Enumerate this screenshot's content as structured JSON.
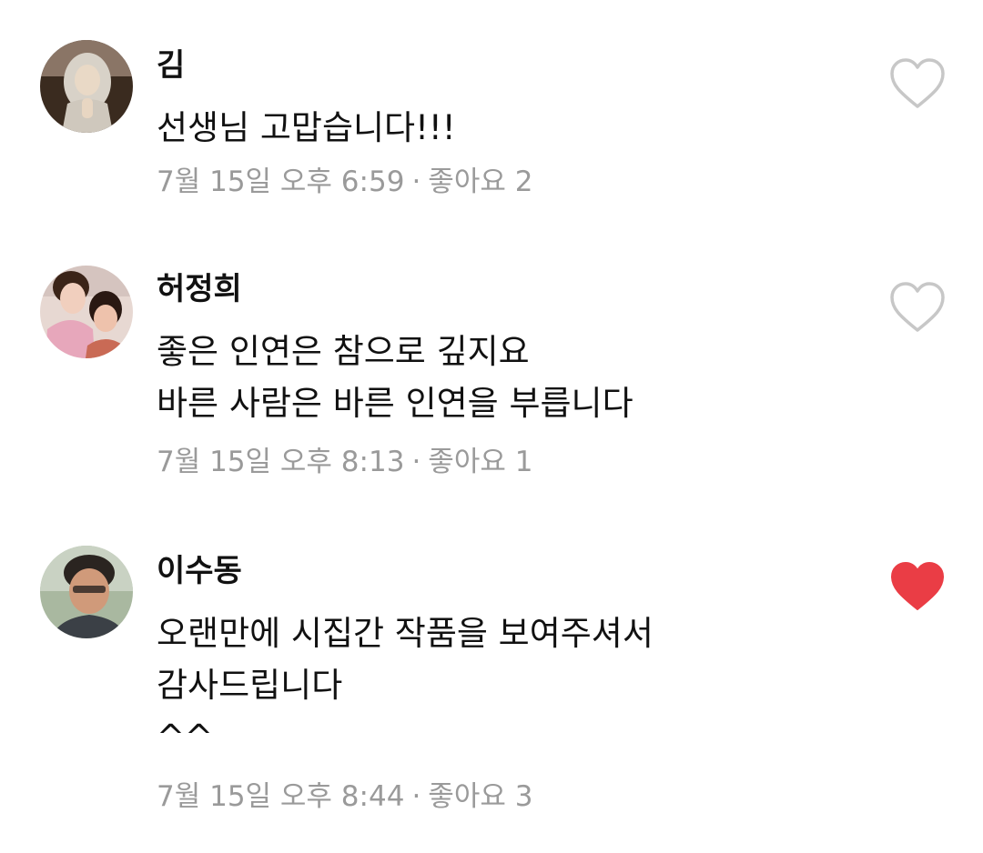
{
  "comments": [
    {
      "author": "김",
      "lines": [
        "선생님 고맙습니다!!!"
      ],
      "time": "7월 15일 오후 6:59",
      "separator": "·",
      "likes": "좋아요 2",
      "liked": false
    },
    {
      "author": "허정희",
      "lines": [
        "좋은 인연은  참으로 깊지요",
        "바른 사람은 바른 인연을 부릅니다"
      ],
      "time": "7월 15일 오후 8:13",
      "separator": "·",
      "likes": "좋아요 1",
      "liked": false
    },
    {
      "author": "이수동",
      "lines": [
        "오랜만에 시집간 작품을 보여주셔서",
        "감사드립니다",
        "^^"
      ],
      "time": "7월 15일 오후 8:44",
      "separator": "·",
      "likes": "좋아요 3",
      "liked": true
    }
  ],
  "colors": {
    "liked_heart": "#ea3d45",
    "unliked_heart": "#c7c7c7",
    "meta_text": "#9a9a9a",
    "body_text": "#111111"
  },
  "icons": {
    "like": "heart-icon",
    "avatar": "avatar-photo"
  }
}
